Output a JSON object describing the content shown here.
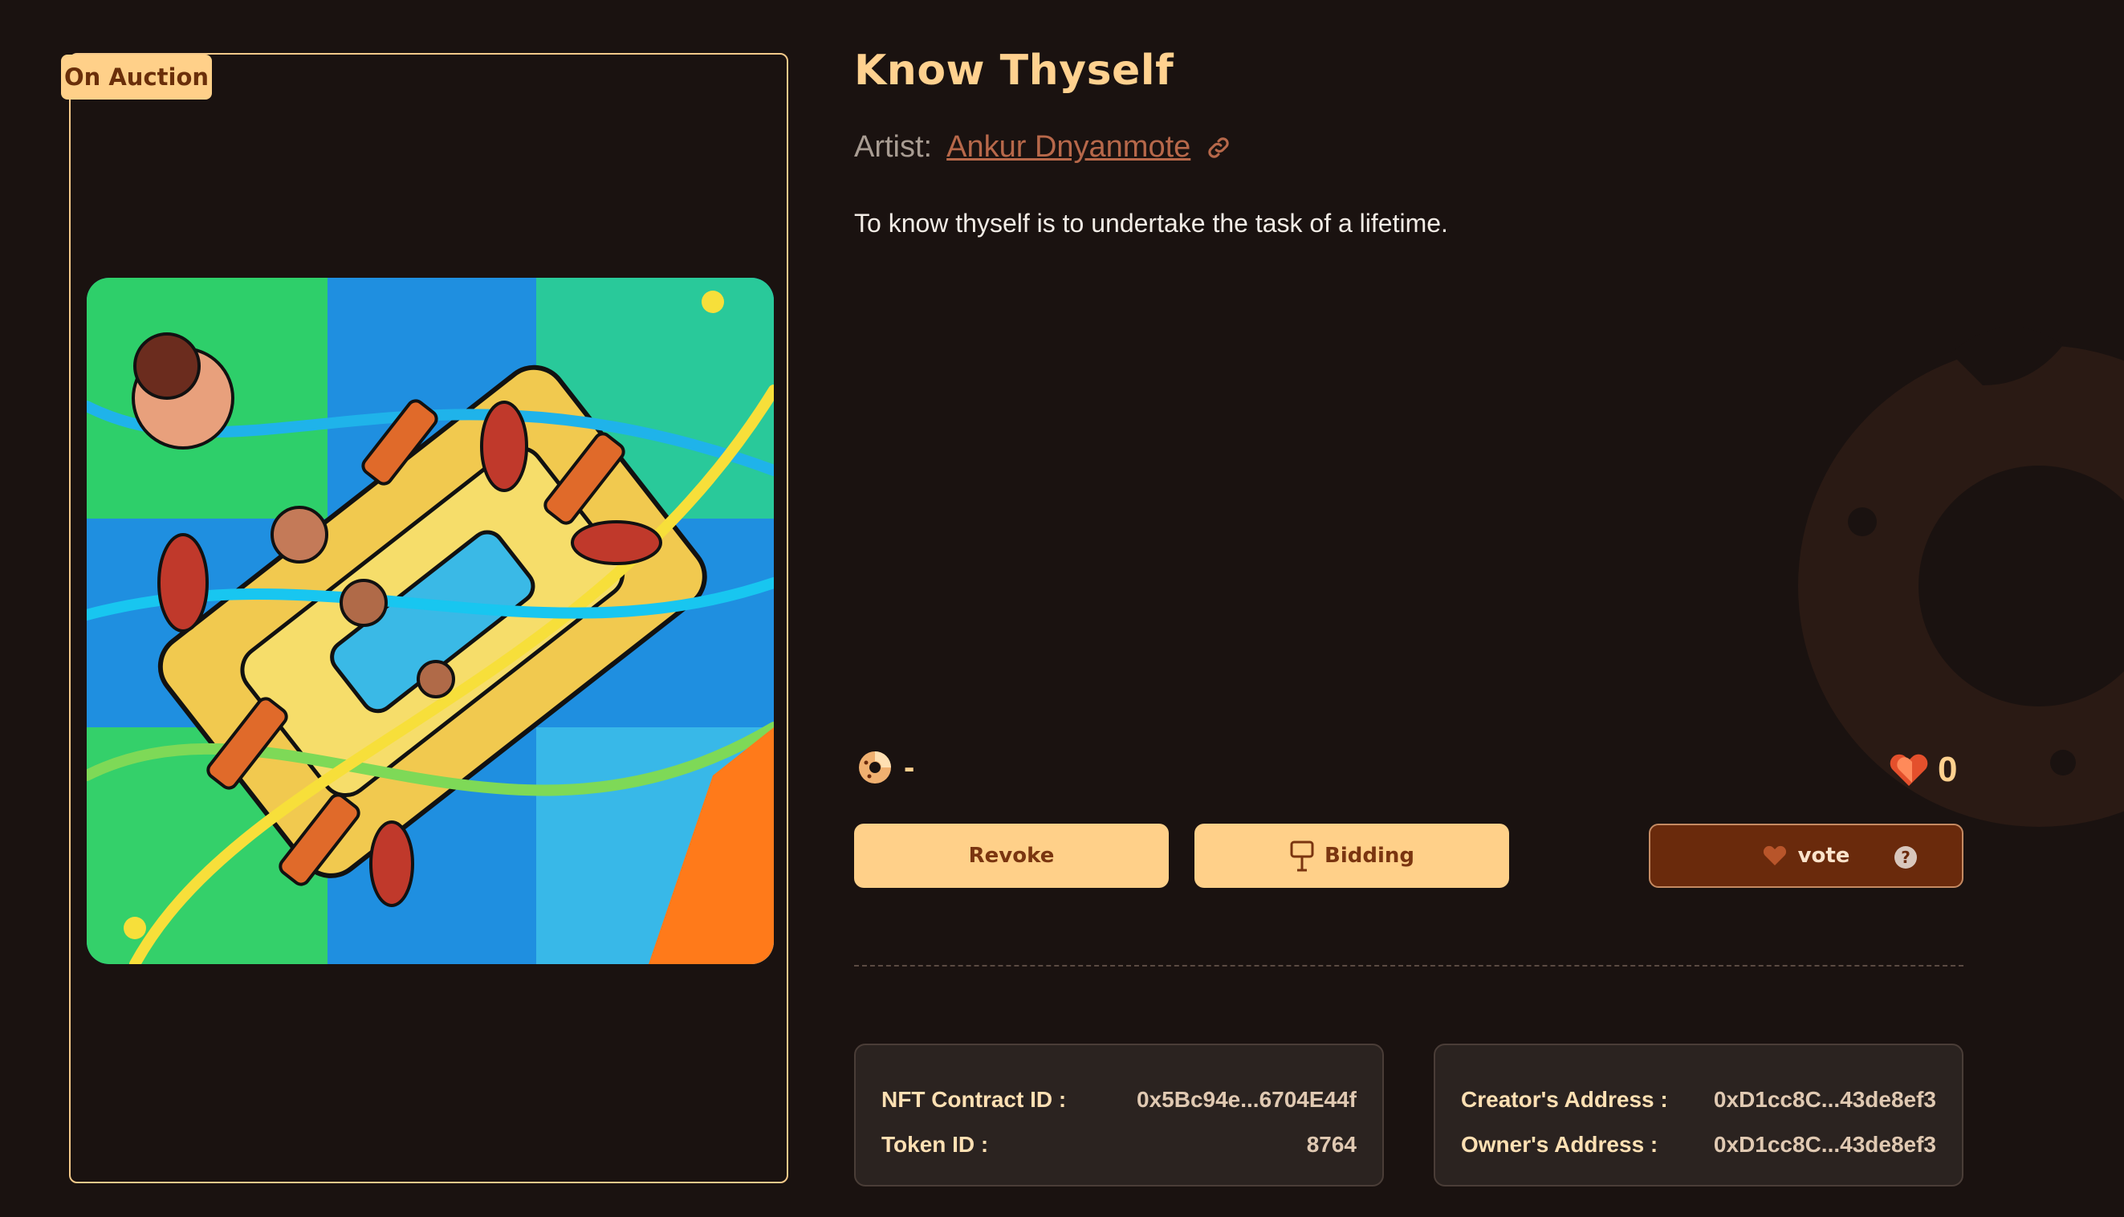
{
  "status_badge": "On Auction",
  "title": "Know Thyself",
  "artist": {
    "label": "Artist:",
    "name": "Ankur Dnyanmote"
  },
  "description": "To know thyself is to undertake the task of a lifetime.",
  "price": {
    "icon": "donut-coin-icon",
    "value": "-"
  },
  "likes": {
    "icon": "heart-icon",
    "count": "0"
  },
  "buttons": {
    "revoke": "Revoke",
    "bidding": "Bidding",
    "vote": "vote",
    "help": "?"
  },
  "contract_info": {
    "nft_contract_label": "NFT Contract ID :",
    "nft_contract_value": "0x5Bc94e...6704E44f",
    "token_label": "Token ID :",
    "token_value": "8764"
  },
  "address_info": {
    "creator_label": "Creator's Address :",
    "creator_value": "0xD1cc8C...43de8ef3",
    "owner_label": "Owner's Address :",
    "owner_value": "0xD1cc8C...43de8ef3"
  },
  "colors": {
    "background": "#1a1210",
    "accent": "#ffd089",
    "title": "#ffd18f",
    "artist_link": "#b7684a",
    "vote_button": "#6a2a0c"
  }
}
